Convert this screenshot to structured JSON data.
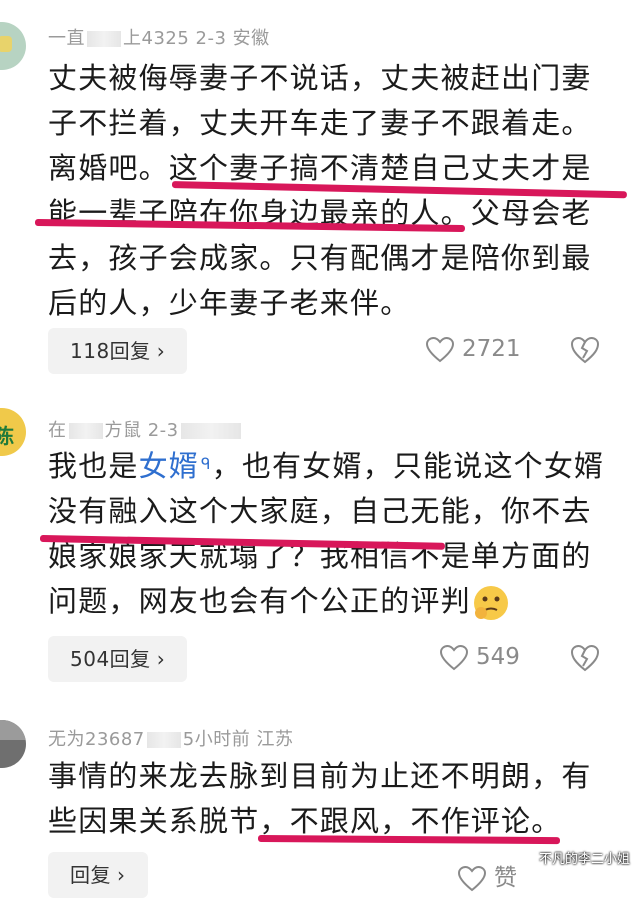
{
  "comments": [
    {
      "meta": "一直",
      "meta_tail": "上4325 2-3 安徽",
      "body": "丈夫被侮辱妻子不说话，丈夫被赶出门妻子不拦着，丈夫开车走了妻子不跟着走。离婚吧。这个妻子搞不清楚自己丈夫才是能一辈子陪在你身边最亲的人。父母会老去，孩子会成家。只有配偶才是陪你到最后的人，少年妻子老来伴。",
      "reply_label": "118回复",
      "likes": "2721"
    },
    {
      "meta": "在",
      "meta_tail": "方鼠 2-3",
      "body_pre": "我也是",
      "keyword": "女婿",
      "body_post": "，也有女婿，只能说这个女婿没有融入这个大家庭，自己无能，你不去娘家娘家天就塌了？我相信不是单方面的问题，网友也会有个公正的评判",
      "reply_label": "504回复",
      "likes": "549"
    },
    {
      "meta": "无为23687",
      "meta_tail": "5小时前 江苏",
      "body": "事情的来龙去脉到目前为止还不明朗，有些因果关系脱节，不跟风，不作评论。",
      "reply_label": "回复",
      "likes": "赞"
    }
  ],
  "watermark": "不凡的李二小姐",
  "colors": {
    "highlight": "#d8175a",
    "keyword": "#2f6fcf"
  }
}
